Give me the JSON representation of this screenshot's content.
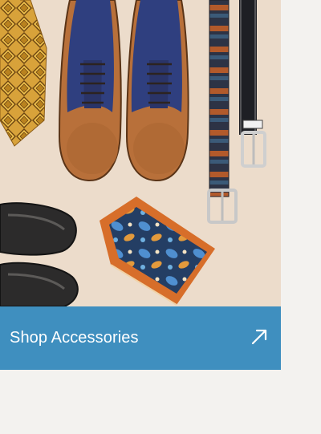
{
  "promo": {
    "cta_label": "Shop Accessories",
    "cta_icon": "arrow-up-right-icon",
    "image_subject": "accessories-flatlay"
  },
  "colors": {
    "cta_background": "#3f8fbf",
    "cta_text": "#ffffff",
    "page_background": "#f3f2ef",
    "photo_background": "#ecdccb"
  }
}
